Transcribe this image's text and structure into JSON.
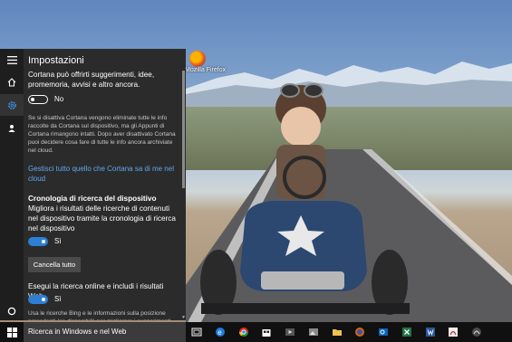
{
  "desktop": {
    "icon_label": "Mozilla Firefox"
  },
  "panel": {
    "title": "Impostazioni",
    "intro": "Cortana può offrirti suggerimenti, idee, promemoria, avvisi e altro ancora.",
    "cortana_toggle_label": "No",
    "cortana_note": "Se si disattiva Cortana vengono eliminate tutte le info raccolte da Cortana sul dispositivo, ma gli Appunti di Cortana rimangono intatti. Dopo aver disattivato Cortana puoi decidere cosa fare di tutte le info ancora archiviate nel cloud.",
    "manage_link": "Gestisci tutto quello che Cortana sa di me nel cloud",
    "history_heading": "Cronologia di ricerca del dispositivo",
    "history_text": "Migliora i risultati delle ricerche di contenuti nel dispositivo tramite la cronologia di ricerca nel dispositivo",
    "history_toggle_label": "Sì",
    "clear_button": "Cancella tutto",
    "web_heading": "Esegui la ricerca online e includi i risultati Web",
    "web_toggle_label": "Sì",
    "web_note": "Usa le ricerche Bing e le informazioni sulla posizione precedenti (se disponibili) per migliorare i suggerimenti"
  },
  "rail": {
    "items": [
      "hamburger-icon",
      "home-icon",
      "settings-icon",
      "feedback-icon"
    ],
    "bottom": "cortana-circle-icon"
  },
  "taskbar": {
    "search_placeholder": "Ricerca in Windows e nel Web",
    "apps": [
      "task-view-icon",
      "edge-icon",
      "chrome-icon",
      "store-icon",
      "media-icon",
      "explorer-icon",
      "firefox-icon",
      "outlook-icon",
      "excel-icon",
      "word-icon",
      "acrobat-icon",
      "app-icon"
    ]
  },
  "colors": {
    "panel_bg": "#2b2b2b",
    "accent": "#2d7fd2",
    "link": "#5fa8f0",
    "taskbar": "#101010"
  }
}
